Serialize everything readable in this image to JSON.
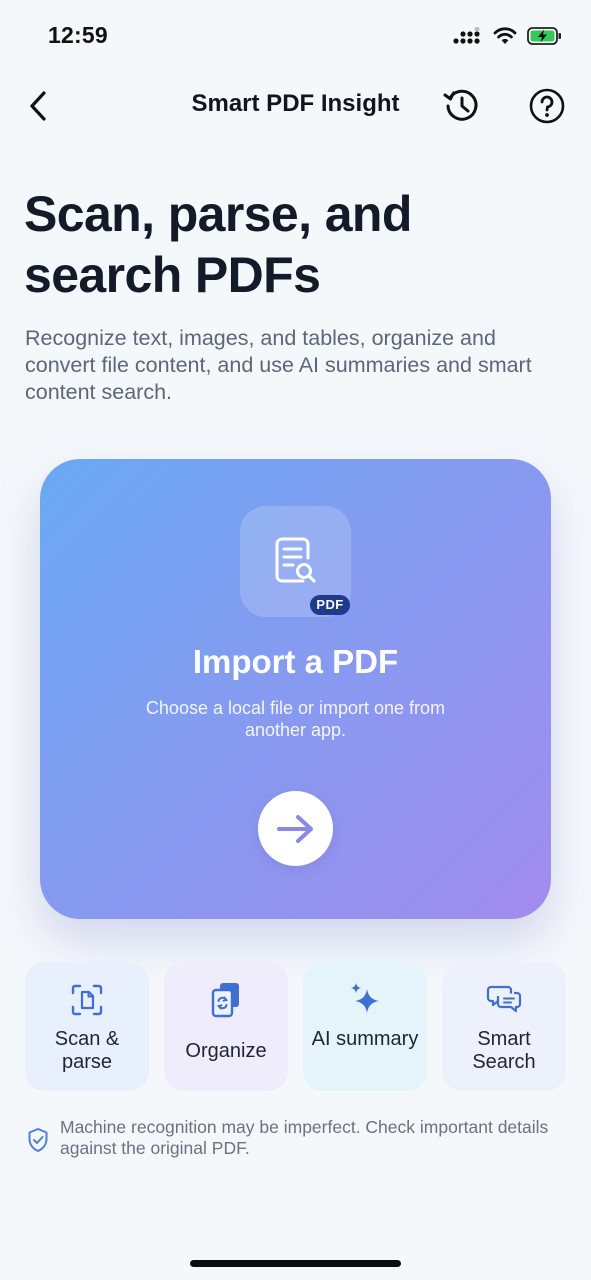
{
  "status_bar": {
    "time": "12:59"
  },
  "nav": {
    "title": "Smart PDF Insight",
    "back_icon": "chevron-left-icon",
    "history_icon": "history-icon",
    "help_icon": "help-circle-icon"
  },
  "hero": {
    "title": "Scan, parse, and search PDFs",
    "description": "Recognize text, images, and tables, organize and convert file content, and use AI summaries and smart content search."
  },
  "import_card": {
    "badge": "PDF",
    "title": "Import a PDF",
    "subtitle": "Choose a local file or import one from another app.",
    "icon": "document-search-icon",
    "action_icon": "arrow-right-icon",
    "gradient_start": "#6aa9f2",
    "gradient_end": "#a28cee"
  },
  "features": [
    {
      "label": "Scan & parse",
      "icon": "scan-document-icon"
    },
    {
      "label": "Organize",
      "icon": "organize-files-icon"
    },
    {
      "label": "AI summary",
      "icon": "sparkles-icon"
    },
    {
      "label": "Smart Search",
      "icon": "chat-bubbles-icon"
    }
  ],
  "disclaimer": {
    "text": "Machine recognition may be imperfect. Check important details against the original PDF.",
    "icon": "shield-check-icon"
  },
  "colors": {
    "background": "#f5f8fb",
    "accent": "#4f7fd6",
    "badge": "#1f3a8a"
  }
}
